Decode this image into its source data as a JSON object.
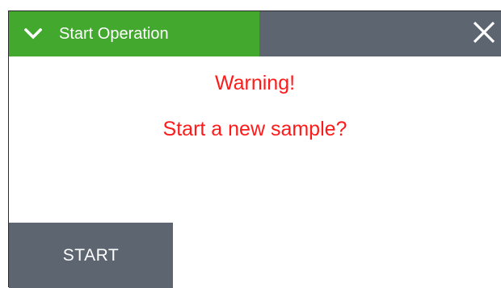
{
  "dialog": {
    "title": "Start Operation",
    "expand_icon": "chevron-down-icon",
    "close_icon": "close-icon",
    "colors": {
      "title_tab": "#43a82e",
      "titlebar": "#5c6570",
      "message": "#ff1a1a",
      "button": "#5c6570"
    }
  },
  "message": {
    "line1": "Warning!",
    "line2": "Start a new sample?"
  },
  "actions": {
    "start_label": "START"
  }
}
